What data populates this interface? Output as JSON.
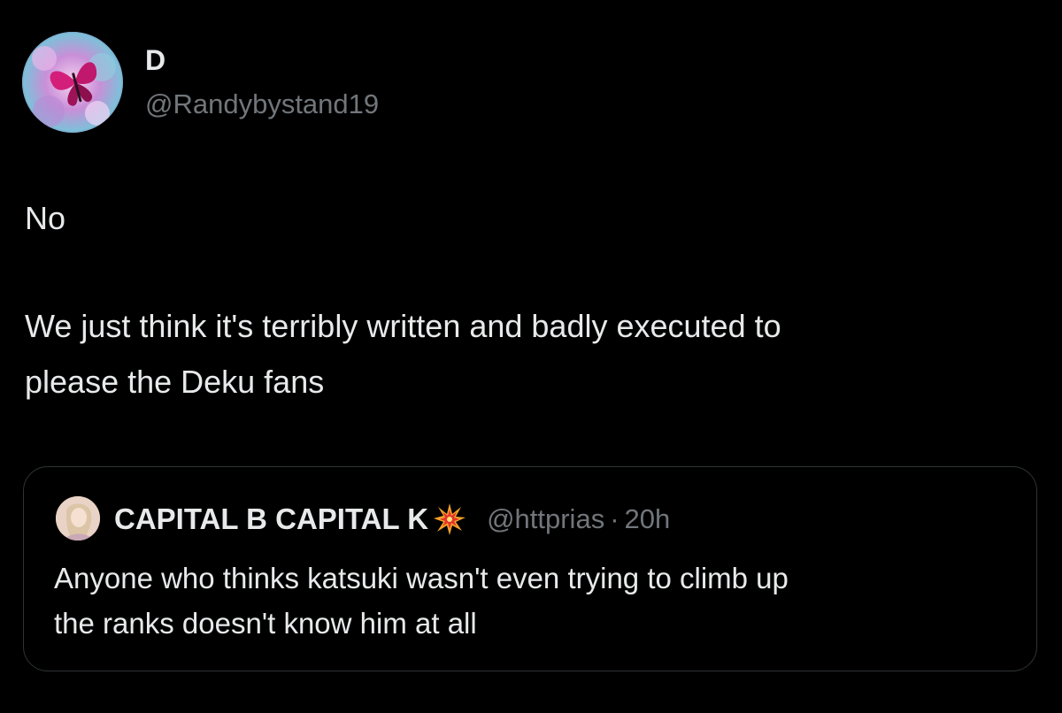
{
  "author": {
    "display_name": "D",
    "handle": "@Randybystand19",
    "avatar_icon": "butterfly-avatar-icon"
  },
  "tweet": {
    "lines": [
      "No",
      "We just think it's terribly written and badly executed to",
      "please the Deku fans"
    ]
  },
  "quoted_tweet": {
    "display_name": "CAPITAL B CAPITAL K",
    "name_emoji": "collision-emoji-icon",
    "handle": "@httprias",
    "separator": "·",
    "time": "20h",
    "lines": [
      "Anyone who thinks katsuki wasn't even trying to climb up",
      "the ranks doesn't know him at all"
    ]
  },
  "colors": {
    "background": "#000000",
    "primary_text": "#e7e9ea",
    "secondary_text": "#71767b",
    "border": "#2f3336"
  }
}
